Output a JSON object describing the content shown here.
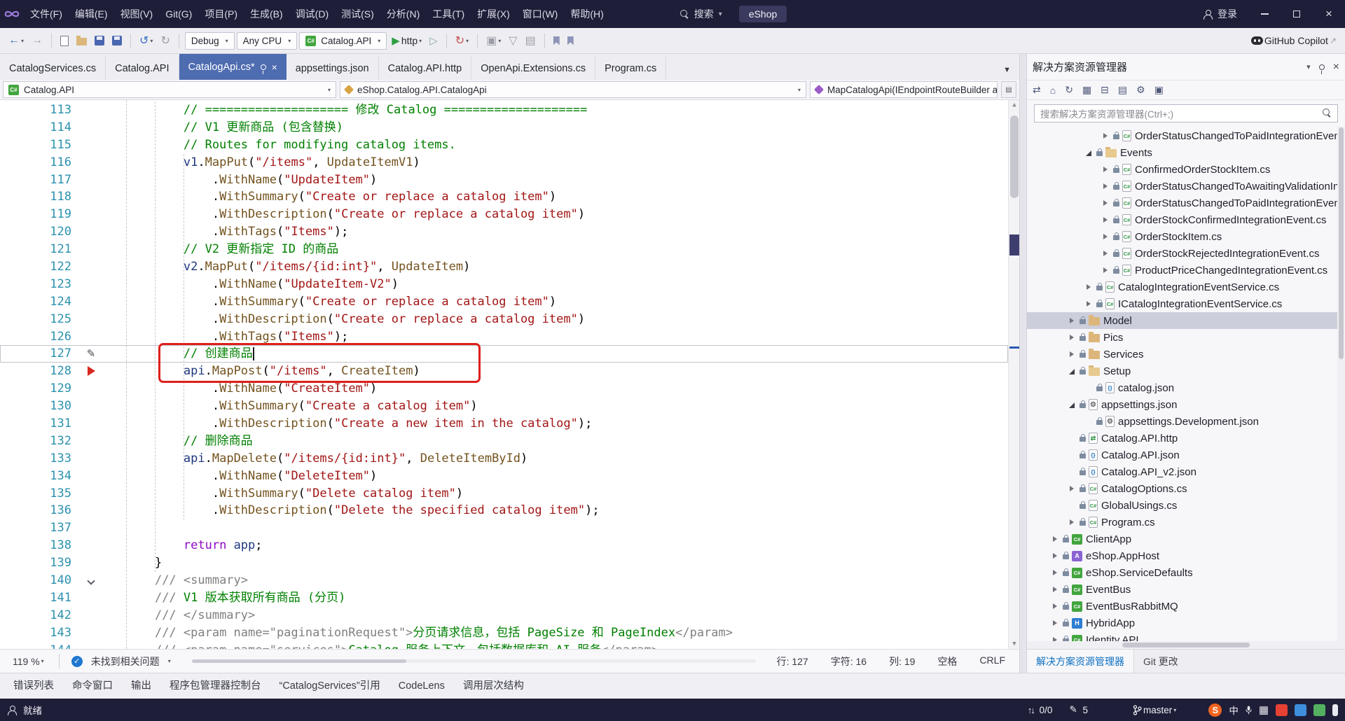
{
  "titlebar": {
    "search_label": "搜索",
    "solution_name": "eShop",
    "sign_in": "登录"
  },
  "menu": {
    "items": [
      "文件(F)",
      "编辑(E)",
      "视图(V)",
      "Git(G)",
      "项目(P)",
      "生成(B)",
      "调试(D)",
      "测试(S)",
      "分析(N)",
      "工具(T)",
      "扩展(X)",
      "窗口(W)",
      "帮助(H)"
    ]
  },
  "toolbar": {
    "debug_target": "Debug",
    "platform": "Any CPU",
    "startup_project": "Catalog.API",
    "run_profile": "http",
    "copilot_label": "GitHub Copilot"
  },
  "tabs": [
    {
      "label": "CatalogServices.cs",
      "active": false
    },
    {
      "label": "Catalog.API",
      "active": false
    },
    {
      "label": "CatalogApi.cs*",
      "active": true
    },
    {
      "label": "appsettings.json",
      "active": false
    },
    {
      "label": "Catalog.API.http",
      "active": false
    },
    {
      "label": "OpenApi.Extensions.cs",
      "active": false
    },
    {
      "label": "Program.cs",
      "active": false
    }
  ],
  "navbar": {
    "project": "Catalog.API",
    "type_name": "eShop.Catalog.API.CatalogApi",
    "member": "MapCatalogApi(IEndpointRouteBuilder app)"
  },
  "editor": {
    "lines": [
      {
        "n": 113,
        "t": [
          {
            "t": "        // ==================== 修改 Catalog ====================",
            "c": "com"
          }
        ]
      },
      {
        "n": 114,
        "t": [
          {
            "t": "        // V1 更新商品 (包含替换)",
            "c": "com"
          }
        ]
      },
      {
        "n": 115,
        "t": [
          {
            "t": "        // Routes for modifying catalog items.",
            "c": "com"
          }
        ]
      },
      {
        "n": 116,
        "t": [
          {
            "t": "        ",
            "c": "pl"
          },
          {
            "t": "v1",
            "c": "loc"
          },
          {
            "t": ".",
            "c": "pun"
          },
          {
            "t": "MapPut",
            "c": "m"
          },
          {
            "t": "(",
            "c": "pun"
          },
          {
            "t": "\"/items\"",
            "c": "str"
          },
          {
            "t": ", ",
            "c": "pun"
          },
          {
            "t": "UpdateItemV1",
            "c": "m"
          },
          {
            "t": ")",
            "c": "pun"
          }
        ]
      },
      {
        "n": 117,
        "t": [
          {
            "t": "            .",
            "c": "pun"
          },
          {
            "t": "WithName",
            "c": "m"
          },
          {
            "t": "(",
            "c": "pun"
          },
          {
            "t": "\"UpdateItem\"",
            "c": "str"
          },
          {
            "t": ")",
            "c": "pun"
          }
        ]
      },
      {
        "n": 118,
        "t": [
          {
            "t": "            .",
            "c": "pun"
          },
          {
            "t": "WithSummary",
            "c": "m"
          },
          {
            "t": "(",
            "c": "pun"
          },
          {
            "t": "\"Create or replace a catalog item\"",
            "c": "str"
          },
          {
            "t": ")",
            "c": "pun"
          }
        ]
      },
      {
        "n": 119,
        "t": [
          {
            "t": "            .",
            "c": "pun"
          },
          {
            "t": "WithDescription",
            "c": "m"
          },
          {
            "t": "(",
            "c": "pun"
          },
          {
            "t": "\"Create or replace a catalog item\"",
            "c": "str"
          },
          {
            "t": ")",
            "c": "pun"
          }
        ]
      },
      {
        "n": 120,
        "t": [
          {
            "t": "            .",
            "c": "pun"
          },
          {
            "t": "WithTags",
            "c": "m"
          },
          {
            "t": "(",
            "c": "pun"
          },
          {
            "t": "\"Items\"",
            "c": "str"
          },
          {
            "t": ");",
            "c": "pun"
          }
        ]
      },
      {
        "n": 121,
        "t": [
          {
            "t": "        // V2 更新指定 ID 的商品",
            "c": "com"
          }
        ]
      },
      {
        "n": 122,
        "t": [
          {
            "t": "        ",
            "c": "pl"
          },
          {
            "t": "v2",
            "c": "loc"
          },
          {
            "t": ".",
            "c": "pun"
          },
          {
            "t": "MapPut",
            "c": "m"
          },
          {
            "t": "(",
            "c": "pun"
          },
          {
            "t": "\"/items/{id:int}\"",
            "c": "str"
          },
          {
            "t": ", ",
            "c": "pun"
          },
          {
            "t": "UpdateItem",
            "c": "m"
          },
          {
            "t": ")",
            "c": "pun"
          }
        ]
      },
      {
        "n": 123,
        "t": [
          {
            "t": "            .",
            "c": "pun"
          },
          {
            "t": "WithName",
            "c": "m"
          },
          {
            "t": "(",
            "c": "pun"
          },
          {
            "t": "\"UpdateItem-V2\"",
            "c": "str"
          },
          {
            "t": ")",
            "c": "pun"
          }
        ]
      },
      {
        "n": 124,
        "t": [
          {
            "t": "            .",
            "c": "pun"
          },
          {
            "t": "WithSummary",
            "c": "m"
          },
          {
            "t": "(",
            "c": "pun"
          },
          {
            "t": "\"Create or replace a catalog item\"",
            "c": "str"
          },
          {
            "t": ")",
            "c": "pun"
          }
        ]
      },
      {
        "n": 125,
        "t": [
          {
            "t": "            .",
            "c": "pun"
          },
          {
            "t": "WithDescription",
            "c": "m"
          },
          {
            "t": "(",
            "c": "pun"
          },
          {
            "t": "\"Create or replace a catalog item\"",
            "c": "str"
          },
          {
            "t": ")",
            "c": "pun"
          }
        ]
      },
      {
        "n": 126,
        "t": [
          {
            "t": "            .",
            "c": "pun"
          },
          {
            "t": "WithTags",
            "c": "m"
          },
          {
            "t": "(",
            "c": "pun"
          },
          {
            "t": "\"Items\"",
            "c": "str"
          },
          {
            "t": ");",
            "c": "pun"
          }
        ]
      },
      {
        "n": 127,
        "cur": true,
        "caret": true,
        "g": "pencil",
        "t": [
          {
            "t": "        // 创建商品",
            "c": "com"
          }
        ]
      },
      {
        "n": 128,
        "g": "bp",
        "t": [
          {
            "t": "        ",
            "c": "pl"
          },
          {
            "t": "api",
            "c": "loc"
          },
          {
            "t": ".",
            "c": "pun"
          },
          {
            "t": "MapPost",
            "c": "m"
          },
          {
            "t": "(",
            "c": "pun"
          },
          {
            "t": "\"/items\"",
            "c": "str"
          },
          {
            "t": ", ",
            "c": "pun"
          },
          {
            "t": "CreateItem",
            "c": "m"
          },
          {
            "t": ")",
            "c": "pun"
          }
        ]
      },
      {
        "n": 129,
        "t": [
          {
            "t": "            .",
            "c": "pun"
          },
          {
            "t": "WithName",
            "c": "m"
          },
          {
            "t": "(",
            "c": "pun"
          },
          {
            "t": "\"CreateItem\"",
            "c": "str"
          },
          {
            "t": ")",
            "c": "pun"
          }
        ]
      },
      {
        "n": 130,
        "t": [
          {
            "t": "            .",
            "c": "pun"
          },
          {
            "t": "WithSummary",
            "c": "m"
          },
          {
            "t": "(",
            "c": "pun"
          },
          {
            "t": "\"Create a catalog item\"",
            "c": "str"
          },
          {
            "t": ")",
            "c": "pun"
          }
        ]
      },
      {
        "n": 131,
        "t": [
          {
            "t": "            .",
            "c": "pun"
          },
          {
            "t": "WithDescription",
            "c": "m"
          },
          {
            "t": "(",
            "c": "pun"
          },
          {
            "t": "\"Create a new item in the catalog\"",
            "c": "str"
          },
          {
            "t": ");",
            "c": "pun"
          }
        ]
      },
      {
        "n": 132,
        "t": [
          {
            "t": "        // 删除商品",
            "c": "com"
          }
        ]
      },
      {
        "n": 133,
        "t": [
          {
            "t": "        ",
            "c": "pl"
          },
          {
            "t": "api",
            "c": "loc"
          },
          {
            "t": ".",
            "c": "pun"
          },
          {
            "t": "MapDelete",
            "c": "m"
          },
          {
            "t": "(",
            "c": "pun"
          },
          {
            "t": "\"/items/{id:int}\"",
            "c": "str"
          },
          {
            "t": ", ",
            "c": "pun"
          },
          {
            "t": "DeleteItemById",
            "c": "m"
          },
          {
            "t": ")",
            "c": "pun"
          }
        ]
      },
      {
        "n": 134,
        "t": [
          {
            "t": "            .",
            "c": "pun"
          },
          {
            "t": "WithName",
            "c": "m"
          },
          {
            "t": "(",
            "c": "pun"
          },
          {
            "t": "\"DeleteItem\"",
            "c": "str"
          },
          {
            "t": ")",
            "c": "pun"
          }
        ]
      },
      {
        "n": 135,
        "t": [
          {
            "t": "            .",
            "c": "pun"
          },
          {
            "t": "WithSummary",
            "c": "m"
          },
          {
            "t": "(",
            "c": "pun"
          },
          {
            "t": "\"Delete catalog item\"",
            "c": "str"
          },
          {
            "t": ")",
            "c": "pun"
          }
        ]
      },
      {
        "n": 136,
        "t": [
          {
            "t": "            .",
            "c": "pun"
          },
          {
            "t": "WithDescription",
            "c": "m"
          },
          {
            "t": "(",
            "c": "pun"
          },
          {
            "t": "\"Delete the specified catalog item\"",
            "c": "str"
          },
          {
            "t": ");",
            "c": "pun"
          }
        ]
      },
      {
        "n": 137,
        "t": []
      },
      {
        "n": 138,
        "t": [
          {
            "t": "        ",
            "c": "pl"
          },
          {
            "t": "return",
            "c": "ctl"
          },
          {
            "t": " ",
            "c": "pl"
          },
          {
            "t": "app",
            "c": "loc"
          },
          {
            "t": ";",
            "c": "pun"
          }
        ]
      },
      {
        "n": 139,
        "t": [
          {
            "t": "    }",
            "c": "pun"
          }
        ]
      },
      {
        "n": 140,
        "g": "fold",
        "t": [
          {
            "t": "    ",
            "c": "pl"
          },
          {
            "t": "/// <summary>",
            "c": "doc"
          }
        ]
      },
      {
        "n": 141,
        "t": [
          {
            "t": "    ",
            "c": "pl"
          },
          {
            "t": "/// ",
            "c": "doc"
          },
          {
            "t": "V1 版本获取所有商品 (分页)",
            "c": "docg"
          }
        ]
      },
      {
        "n": 142,
        "t": [
          {
            "t": "    ",
            "c": "pl"
          },
          {
            "t": "/// </summary>",
            "c": "doc"
          }
        ]
      },
      {
        "n": 143,
        "t": [
          {
            "t": "    ",
            "c": "pl"
          },
          {
            "t": "/// <param name=\"paginationRequest\">",
            "c": "doc"
          },
          {
            "t": "分页请求信息，包括 PageSize 和 PageIndex",
            "c": "docg"
          },
          {
            "t": "</param>",
            "c": "doc"
          }
        ]
      },
      {
        "n": 144,
        "t": [
          {
            "t": "    ",
            "c": "pl"
          },
          {
            "t": "/// <param name=\"services\">",
            "c": "doc"
          },
          {
            "t": "Catalog 服务上下文，包括数据库和 AI 服务",
            "c": "docg"
          },
          {
            "t": "</param>",
            "c": "doc"
          }
        ]
      }
    ]
  },
  "editor_status": {
    "zoom": "119 %",
    "health": "未找到相关问题",
    "line": "行: 127",
    "char": "字符: 16",
    "col": "列: 19",
    "spaces": "空格",
    "eol": "CRLF"
  },
  "panel_tabs": [
    "错误列表",
    "命令窗口",
    "输出",
    "程序包管理器控制台",
    "“CatalogServices”引用",
    "CodeLens",
    "调用层次结构"
  ],
  "solution_explorer": {
    "title": "解决方案资源管理器",
    "search_placeholder": "搜索解决方案资源管理器(Ctrl+;)",
    "bottom_tabs": [
      {
        "label": "解决方案资源管理器",
        "active": true
      },
      {
        "label": "Git 更改",
        "active": false
      }
    ],
    "tree": [
      {
        "lvl": 4,
        "exp": "c",
        "icon": "cs",
        "label": "OrderStatusChangedToPaidIntegrationEventHandler.cs"
      },
      {
        "lvl": 3,
        "exp": "o",
        "icon": "folder-open",
        "label": "Events"
      },
      {
        "lvl": 4,
        "exp": "c",
        "icon": "cs",
        "label": "ConfirmedOrderStockItem.cs"
      },
      {
        "lvl": 4,
        "exp": "c",
        "icon": "cs",
        "label": "OrderStatusChangedToAwaitingValidationIntegrationEvent.cs"
      },
      {
        "lvl": 4,
        "exp": "c",
        "icon": "cs",
        "label": "OrderStatusChangedToPaidIntegrationEvent.cs"
      },
      {
        "lvl": 4,
        "exp": "c",
        "icon": "cs",
        "label": "OrderStockConfirmedIntegrationEvent.cs"
      },
      {
        "lvl": 4,
        "exp": "c",
        "icon": "cs",
        "label": "OrderStockItem.cs"
      },
      {
        "lvl": 4,
        "exp": "c",
        "icon": "cs",
        "label": "OrderStockRejectedIntegrationEvent.cs"
      },
      {
        "lvl": 4,
        "exp": "c",
        "icon": "cs",
        "label": "ProductPriceChangedIntegrationEvent.cs"
      },
      {
        "lvl": 3,
        "exp": "c",
        "icon": "cs",
        "label": "CatalogIntegrationEventService.cs"
      },
      {
        "lvl": 3,
        "exp": "c",
        "icon": "cs",
        "label": "ICatalogIntegrationEventService.cs"
      },
      {
        "lvl": 2,
        "exp": "c",
        "icon": "folder",
        "label": "Model",
        "selected": true
      },
      {
        "lvl": 2,
        "exp": "c",
        "icon": "folder",
        "label": "Pics"
      },
      {
        "lvl": 2,
        "exp": "c",
        "icon": "folder",
        "label": "Services"
      },
      {
        "lvl": 2,
        "exp": "o",
        "icon": "folder-open",
        "label": "Setup"
      },
      {
        "lvl": 3,
        "icon": "json",
        "label": "catalog.json"
      },
      {
        "lvl": 2,
        "exp": "o",
        "icon": "gear",
        "label": "appsettings.json"
      },
      {
        "lvl": 3,
        "icon": "gear",
        "label": "appsettings.Development.json"
      },
      {
        "lvl": 2,
        "icon": "http",
        "label": "Catalog.API.http"
      },
      {
        "lvl": 2,
        "icon": "json",
        "label": "Catalog.API.json"
      },
      {
        "lvl": 2,
        "icon": "json",
        "label": "Catalog.API_v2.json"
      },
      {
        "lvl": 2,
        "exp": "c",
        "icon": "cs",
        "label": "CatalogOptions.cs"
      },
      {
        "lvl": 2,
        "icon": "cs",
        "label": "GlobalUsings.cs"
      },
      {
        "lvl": 2,
        "exp": "c",
        "icon": "cs",
        "label": "Program.cs"
      },
      {
        "lvl": 1,
        "exp": "c",
        "icon": "proj",
        "label": "ClientApp"
      },
      {
        "lvl": 1,
        "exp": "c",
        "icon": "proj-purple",
        "label": "eShop.AppHost"
      },
      {
        "lvl": 1,
        "exp": "c",
        "icon": "proj",
        "label": "eShop.ServiceDefaults"
      },
      {
        "lvl": 1,
        "exp": "c",
        "icon": "proj",
        "label": "EventBus"
      },
      {
        "lvl": 1,
        "exp": "c",
        "icon": "proj",
        "label": "EventBusRabbitMQ"
      },
      {
        "lvl": 1,
        "exp": "c",
        "icon": "proj-blue",
        "label": "HybridApp"
      },
      {
        "lvl": 1,
        "exp": "c",
        "icon": "proj",
        "label": "Identity.API"
      }
    ]
  },
  "status_bar": {
    "ready": "就绪",
    "sync": "0/0",
    "pending": "5",
    "branch": "master",
    "ime": "中"
  },
  "icons": {
    "chevron": "▾",
    "dropdown": "▼",
    "back": "←",
    "forward": "→",
    "undo": "↺",
    "redo": "↻",
    "play": "▶",
    "play-outline": "▷",
    "refresh": "↻",
    "sync": "⇄",
    "home": "⌂",
    "gear": "⚙",
    "grid": "▦",
    "columns": "▣",
    "rows": "▤",
    "collapse": "⊟",
    "external": "↗",
    "close": "×",
    "check": "✓",
    "flask": "▽",
    "up": "▲",
    "down": "▼",
    "updown": "↑↓",
    "pencil": "✎",
    "tree-cs": "C#",
    "tree-json": "{}",
    "tree-gear": "⚙",
    "tree-http": "⇄",
    "tree-proj": "C#",
    "tree-proj-purple": "A",
    "tree-proj-blue": "H"
  }
}
